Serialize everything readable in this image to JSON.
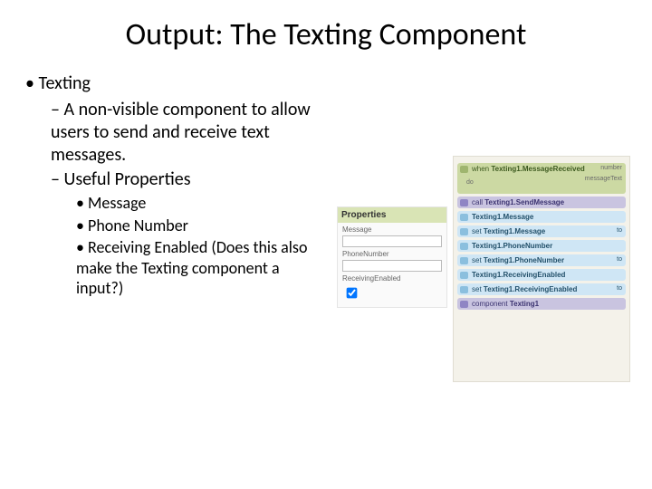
{
  "title": "Output: The Texting Component",
  "bullets": {
    "l1": "Texting",
    "l2a": "A non-visible component to allow users to send and receive text messages.",
    "l2b": "Useful Properties",
    "l3a": "Message",
    "l3b": "Phone Number",
    "l3c": "Receiving Enabled (Does this also make the Texting component a input?)"
  },
  "props": {
    "header": "Properties",
    "message_label": "Message",
    "message_value": "",
    "phone_label": "PhoneNumber",
    "phone_value": "",
    "recv_label": "ReceivingEnabled",
    "recv_checked": true
  },
  "blocks": {
    "event": {
      "prefix": "when",
      "label": "Texting1.MessageReceived",
      "arg1": "number",
      "arg2": "messageText",
      "do": "do"
    },
    "call": {
      "prefix": "call",
      "label": "Texting1.SendMessage"
    },
    "msg_get": {
      "label": "Texting1.Message"
    },
    "msg_set": {
      "prefix": "set",
      "label": "Texting1.Message",
      "suffix": "to"
    },
    "ph_get": {
      "label": "Texting1.PhoneNumber"
    },
    "ph_set": {
      "prefix": "set",
      "label": "Texting1.PhoneNumber",
      "suffix": "to"
    },
    "re_get": {
      "label": "Texting1.ReceivingEnabled"
    },
    "re_set": {
      "prefix": "set",
      "label": "Texting1.ReceivingEnabled",
      "suffix": "to"
    },
    "comp": {
      "prefix": "component",
      "label": "Texting1"
    }
  }
}
